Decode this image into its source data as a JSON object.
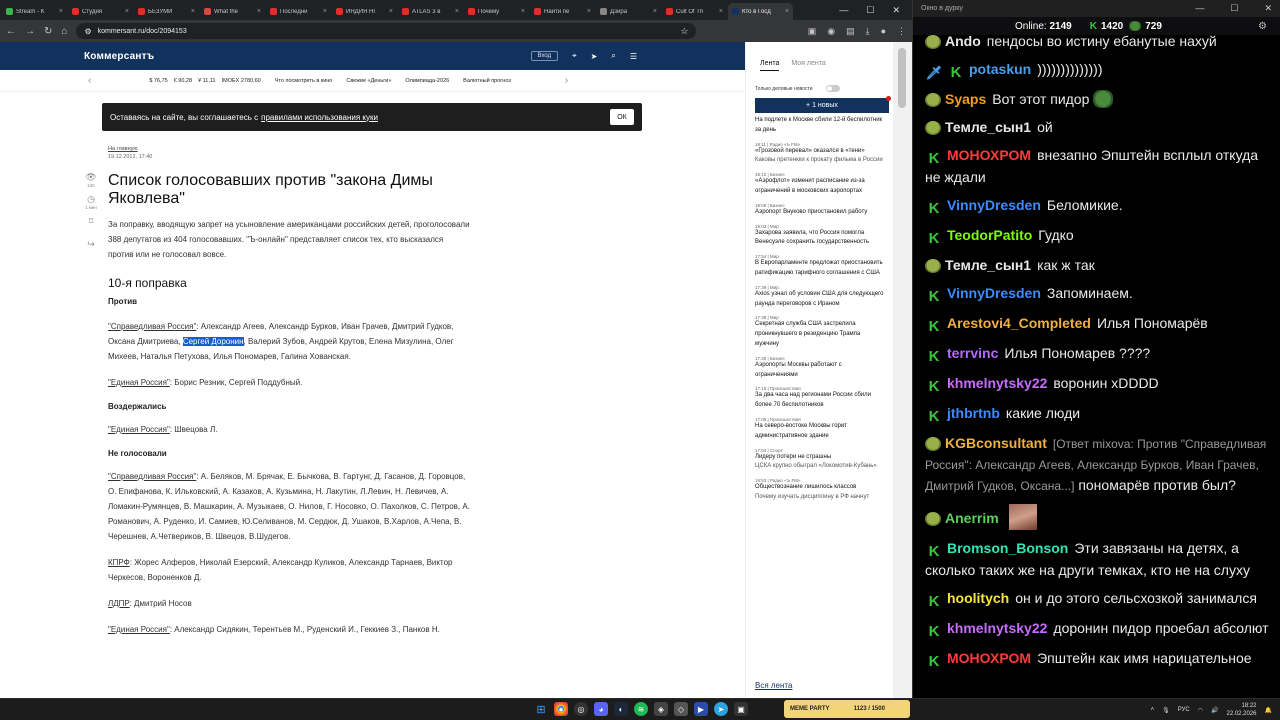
{
  "browser": {
    "tabs": [
      {
        "title": "Stream - K",
        "color": "#39b54a"
      },
      {
        "title": "Студия",
        "color": "#e52d27"
      },
      {
        "title": "БЕЗУМИ",
        "color": "#e52d27"
      },
      {
        "title": "What the",
        "color": "#d44"
      },
      {
        "title": "Последни",
        "color": "#e52d27"
      },
      {
        "title": "ИНДИЯ НІ",
        "color": "#e52d27"
      },
      {
        "title": "ATLAS 3 в",
        "color": "#e52d27"
      },
      {
        "title": "Почему",
        "color": "#e52d27"
      },
      {
        "title": "Найти пе",
        "color": "#e52d27"
      },
      {
        "title": "Дзира",
        "color": "#888"
      },
      {
        "title": "Cult Of Th",
        "color": "#e52d27"
      },
      {
        "title": "Кто в Госд",
        "color": "#12325e"
      }
    ],
    "url": "kommersant.ru/doc/2094153"
  },
  "site": {
    "logo": "Коммерсантъ",
    "login": "Вход",
    "ticker": [
      "$ 76,75",
      "€ 90,28",
      "¥ 11,11",
      "IMOEX 2780,60",
      "Что посмотреть в кино",
      "Свежие «Деньги»",
      "Олимпиада-2026",
      "Валютный прогноз"
    ]
  },
  "cookie": {
    "text": "Оставаясь на сайте, вы соглашаетесь с",
    "link": "правилами использования куки",
    "ok": "ОК"
  },
  "side": {
    "views": "10К",
    "time": "1 мин"
  },
  "article": {
    "crumb": "На главную",
    "date": "19.12.2012, 17:40",
    "title": "Список голосовавших против \"закона Димы Яковлева\"",
    "lead": "За поправку, вводящую запрет на усыновление американцами российских детей, проголосовали 388 депутатов из 404 голосовавших. \"Ъ-онлайн\" представляет список тех, кто высказался против или не голосовал вовсе.",
    "subtitle": "10-я поправка",
    "against": "Против",
    "sr_party": "\"Справедливая Россия\"",
    "sr_text_a": ": Александр Агеев, Александр Бурков, Иван Грачев, Дмитрий Гудков, Оксана Дмитриева, ",
    "sr_highlight": "Сергей Доронин",
    "sr_text_b": ", Валерий Зубов, Андрей Крутов, Елена Мизулина, Олег Михеев, Наталья Петухова, Илья Пономарев, Галина Хованская.",
    "er_party": "\"Единая Россия\"",
    "er_text1": ": Борис Резник, Сергей Поддубный.",
    "abstained": "Воздержались",
    "er_text2": ": Швецова Л.",
    "not_voted": "Не голосовали",
    "sr_text2": ": А. Беляков, М. Брячак, Е. Бычкова, В. Гартунг, Д. Гасанов, Д. Горовцов, О. Епифанова, К. Ильковский, А. Казаков, А. Кузьмина, Н. Лакутин, Л.Левин, Н. Левичев, А. Ломакин-Румянцев, В. Машкарин, А. Музыкаев, О. Нилов, Г. Носовко, О. Пахолков, С. Петров, А. Романович, А. Руденко, И. Самиев, Ю.Селиванов, М. Сердюк, Д. Ушаков, В.Харлов, А.Чепа, В. Черешнев, А.Четвериков, В. Швецов, В.Шудегов.",
    "kprf_party": "КПРФ",
    "kprf_text": ": Жорес Алферов, Николай Езерский, Александр Куликов, Александр Тарнаев, Виктор Черкесов, Вороненков Д.",
    "ldpr_party": "ЛДПР",
    "ldpr_text": ": Дмитрий Носов",
    "er_text3": ": Александр Сидякин, Терентьев М., Руденский И., Геккиев З., Панков Н."
  },
  "feed": {
    "tab_active": "Лента",
    "tab_other": "Моя лента",
    "toggle": "Только деловые новости",
    "new_btn": "+ 1 новых",
    "items": [
      {
        "meta": "",
        "title": "На подлете к Москве сбили 12-й беспилотник за день",
        "sub": ""
      },
      {
        "meta": "18:11 | Радио «Ъ FM»",
        "title": "«Грозовой перевал» оказался в «тени»",
        "sub": "Каковы претенкки к прокату фильма в России"
      },
      {
        "meta": "18:10 | Бизнес",
        "title": "«Аэрофлот» изменит расписание из-за ограничений в московских аэропортах",
        "sub": ""
      },
      {
        "meta": "18:09 | Бизнес",
        "title": "Аэропорт Внуково приостановил работу",
        "sub": ""
      },
      {
        "meta": "18:03 | Мир",
        "title": "Захарова заявила, что Россия помогла Венесуэле сохранить государственность",
        "sub": ""
      },
      {
        "meta": "17:54 | Мир",
        "title": "В Европарламенте предложат приостановить ратификацию тарифного соглашения с США",
        "sub": ""
      },
      {
        "meta": "17:39 | Мир",
        "title": "Axios узнал об условии США для следующего раунда переговоров с Ираном",
        "sub": ""
      },
      {
        "meta": "17:38 | Мир",
        "title": "Секретная служба США застрелила проникнувшего в резиденцию Трампа мужчину",
        "sub": ""
      },
      {
        "meta": "17:25 | Бизнес",
        "title": "Аэропорты Москвы работают с ограничениями",
        "sub": ""
      },
      {
        "meta": "17:15 | Происшествия",
        "title": "За два часа над регионами России сбили более 70 беспилотников",
        "sub": ""
      },
      {
        "meta": "17:05 | Происшествия",
        "title": "На северо-востоке Москвы горит административное здание",
        "sub": ""
      },
      {
        "meta": "17:04 | Спорт",
        "title": "Лидеру потери не страшны",
        "sub": "ЦСКА крупно обыграл «Локомотив-Кубань»"
      },
      {
        "meta": "16:53 | Радио «Ъ FM»",
        "title": "Обществознание лишилось классов",
        "sub": "Почему изучать дисциплину в РФ начнут"
      }
    ],
    "all": "Вся лента"
  },
  "chat": {
    "window_title": "Окно в дурку",
    "online_label": "Online:",
    "online_count": "2149",
    "k_points": "1420",
    "pepe_points": "729",
    "messages": [
      {
        "badge": "pepe",
        "nick": "Ando",
        "color": "#e8e8e8",
        "text": "пендосы во истину ебанутые нахуй"
      },
      {
        "badge": "knife",
        "badge2": "k",
        "nick": "potaskun",
        "color": "#4a9fe8",
        "text": "))))))))))))))"
      },
      {
        "badge": "pepe",
        "nick": "Syaps",
        "color": "#f0a020",
        "text": "Вот этот пидор",
        "emote": true
      },
      {
        "badge": "pepe",
        "nick": "Темле_сын1",
        "color": "#e8e8e8",
        "text": "ой"
      },
      {
        "badge": "k",
        "nick": "МОНОХРОМ",
        "color": "#ff3b3b",
        "text": "внезапно Эпштейн всплыл откуда не ждали"
      },
      {
        "badge": "k",
        "nick": "VinnyDresden",
        "color": "#3b8cff",
        "text": "Беломикие."
      },
      {
        "badge": "k",
        "nick": "TeodorPatito",
        "color": "#7cfc00",
        "text": "Гудко"
      },
      {
        "badge": "pepe",
        "nick": "Темле_сын1",
        "color": "#e8e8e8",
        "text": "как ж так"
      },
      {
        "badge": "k",
        "nick": "VinnyDresden",
        "color": "#3b8cff",
        "text": "Запоминаем."
      },
      {
        "badge": "k",
        "nick": "Arestovi4_Completed",
        "color": "#f0b040",
        "text": "Илья Пономарёв"
      },
      {
        "badge": "k",
        "nick": "terrvinc",
        "color": "#b36bff",
        "text": "Илья Пономарев ????"
      },
      {
        "badge": "k",
        "nick": "khmelnytsky22",
        "color": "#c86bff",
        "text": "воронин хDDDD"
      },
      {
        "badge": "k",
        "nick": "jthbrtnb",
        "color": "#3b8cff",
        "text": "какие люди"
      },
      {
        "badge": "pepe",
        "nick": "KGBconsultant",
        "color": "#f0b040",
        "reply": "[Ответ mixova: Против \"Справедливая Россия\": Александр Агеев, Александр Бурков, Иван Грачев, Дмитрий Гудков, Оксана...]",
        "text": "пономарёв против был?"
      },
      {
        "badge": "pepe",
        "nick": "Anerrim",
        "color": "#5ccf5c",
        "text": "",
        "avatar": true
      },
      {
        "badge": "k",
        "nick": "Bromson_Bonson",
        "color": "#2ee6b8",
        "text": "Эти завязаны на детях, а сколько таких же на други темках, кто не на слуху"
      },
      {
        "badge": "k",
        "nick": "hoolitych",
        "color": "#f8e63a",
        "text": "он и до этого сельсхозкой занимался"
      },
      {
        "badge": "k",
        "nick": "khmelnytsky22",
        "color": "#c86bff",
        "text": "доронин пидор проебал абсолют"
      },
      {
        "badge": "k",
        "nick": "МОНОХРОМ",
        "color": "#ff3b3b",
        "text": "Эпштейн как имя нарицательное"
      }
    ]
  },
  "taskbar": {
    "widget_name": "MEME PARTY",
    "widget_count": "1123 / 1500",
    "lang": "РУС",
    "time": "18:22",
    "date": "22.02.2026"
  }
}
